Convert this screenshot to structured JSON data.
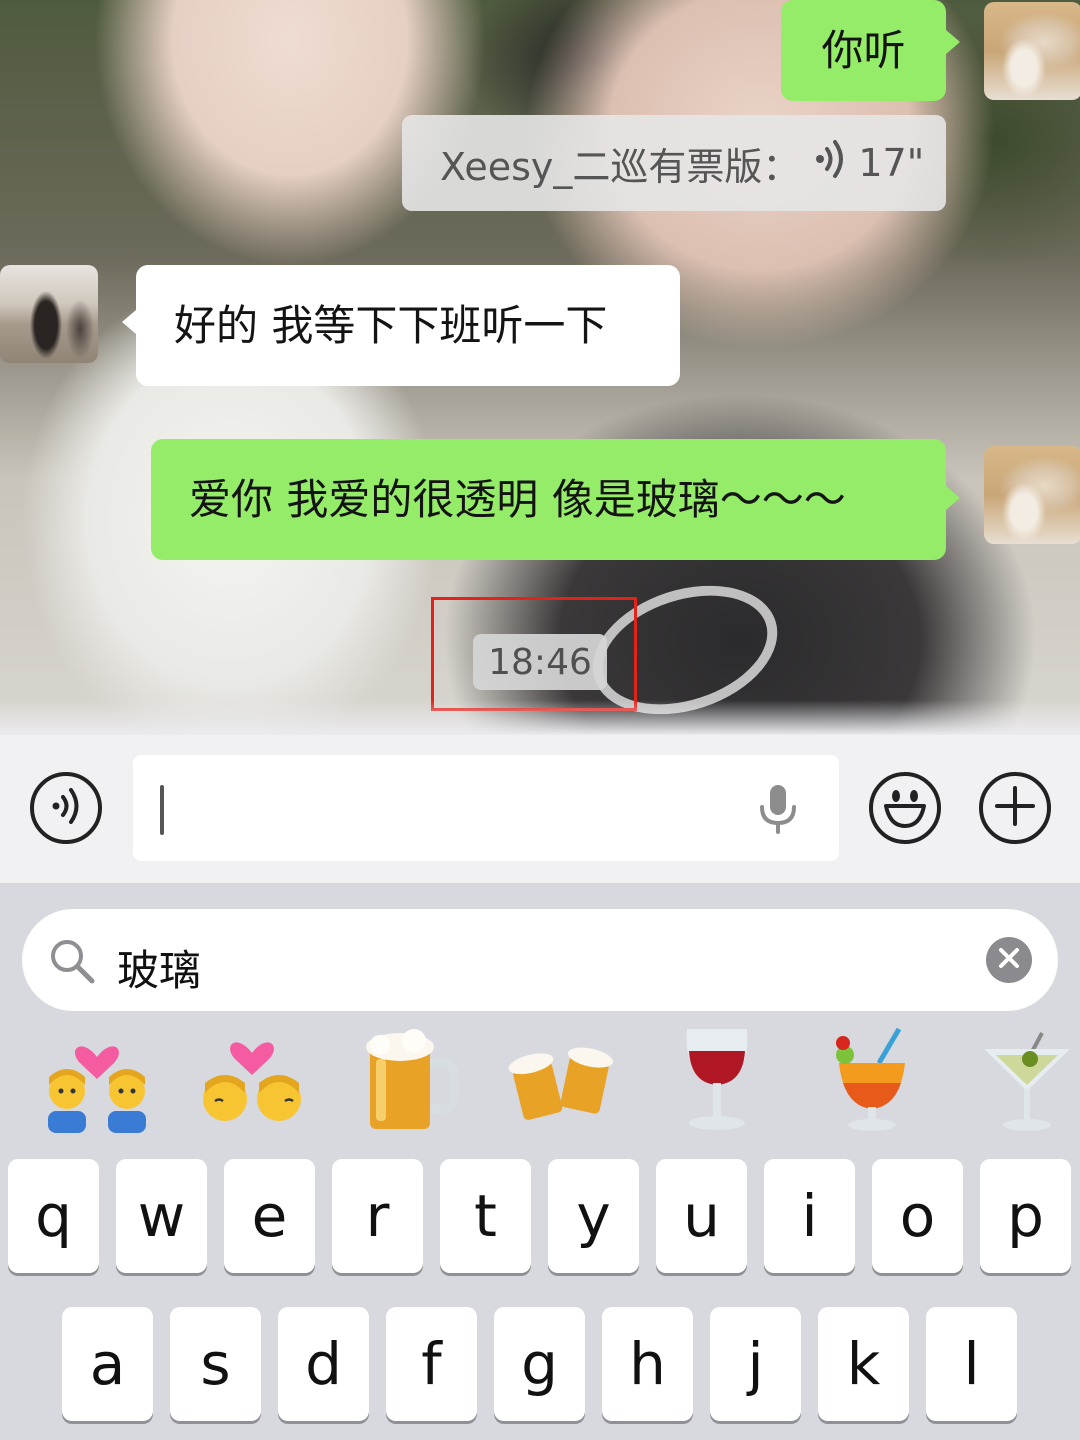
{
  "chat": {
    "messages": [
      {
        "side": "right",
        "type": "text",
        "text": "你听"
      },
      {
        "side": "right",
        "type": "voice",
        "sender": "Xeesy_二巡有票版：",
        "duration": "17\""
      },
      {
        "side": "left",
        "type": "text",
        "text": "好的 我等下下班听一下"
      },
      {
        "side": "right",
        "type": "text",
        "text": "爱你 我爱的很透明 像是玻璃～～～"
      }
    ],
    "timestamp": "18:46"
  },
  "input_bar": {
    "voice_toggle_icon": "voice-wave-icon",
    "mic_icon": "microphone-icon",
    "emoji_icon": "smiley-icon",
    "plus_icon": "plus-icon",
    "value": ""
  },
  "emoji_search": {
    "query": "玻璃",
    "results": [
      "couple-with-heart-man-man",
      "kiss-man-man",
      "beer-mug",
      "clinking-beer-mugs",
      "wine-glass",
      "tropical-drink",
      "cocktail-glass"
    ]
  },
  "keyboard": {
    "row1": [
      "q",
      "w",
      "e",
      "r",
      "t",
      "y",
      "u",
      "i",
      "o",
      "p"
    ],
    "row2": [
      "a",
      "s",
      "d",
      "f",
      "g",
      "h",
      "j",
      "k",
      "l"
    ]
  },
  "colors": {
    "sent_bubble": "#95ec69",
    "received_bubble": "#ffffff",
    "highlight_box": "#e2231a"
  }
}
